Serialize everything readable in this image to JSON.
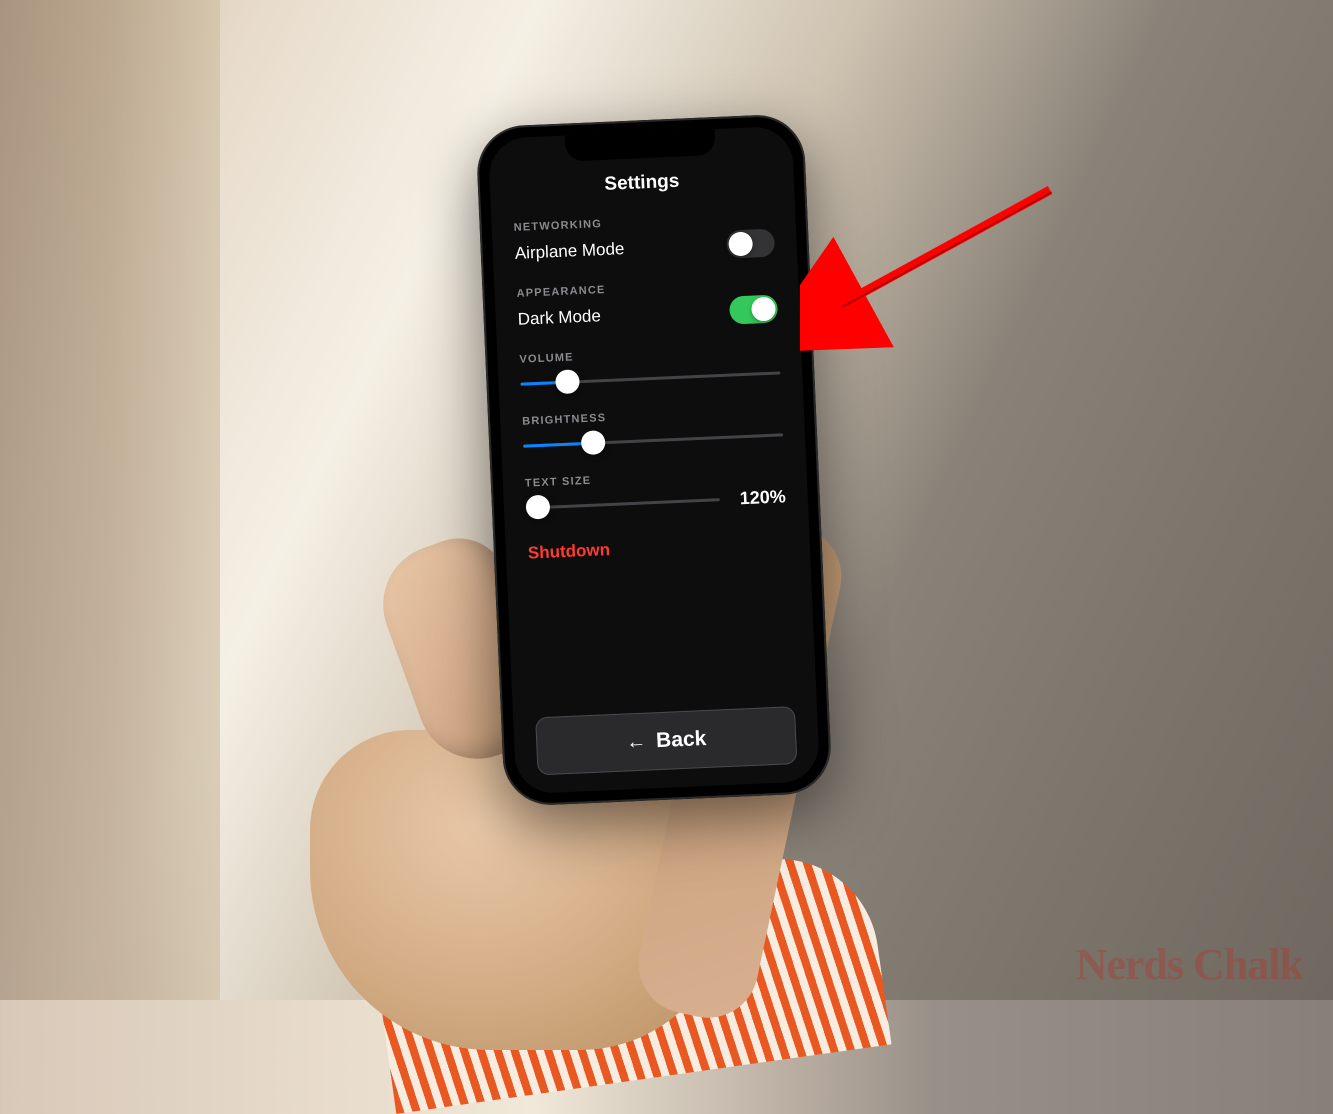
{
  "page": {
    "title": "Settings"
  },
  "sections": {
    "networking": {
      "header": "NETWORKING",
      "airplane": {
        "label": "Airplane Mode",
        "on": false
      }
    },
    "appearance": {
      "header": "APPEARANCE",
      "darkmode": {
        "label": "Dark Mode",
        "on": true
      }
    },
    "volume": {
      "header": "VOLUME",
      "percent": 18
    },
    "brightness": {
      "header": "BRIGHTNESS",
      "percent": 27
    },
    "textsize": {
      "header": "TEXT SIZE",
      "percent": 6,
      "display": "120%"
    }
  },
  "actions": {
    "shutdown": "Shutdown",
    "back": "Back"
  },
  "watermark": "Nerds Chalk",
  "annotation": {
    "target": "dark-mode-toggle",
    "color": "#ff0000"
  }
}
